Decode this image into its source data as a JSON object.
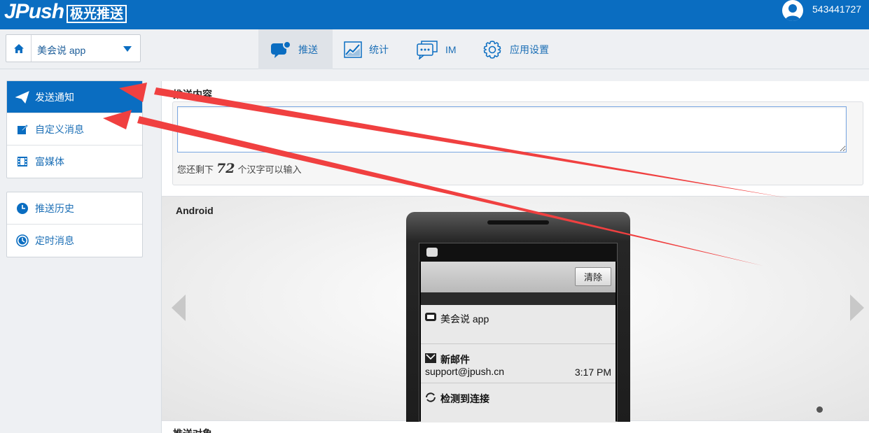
{
  "header": {
    "logo_text": "JPush",
    "logo_cn": "极光推送",
    "username": "543441727"
  },
  "nav": {
    "app_name": "美会说 app",
    "tabs": [
      {
        "label": "推送",
        "active": true
      },
      {
        "label": "统计",
        "active": false
      },
      {
        "label": "IM",
        "active": false
      },
      {
        "label": "应用设置",
        "active": false
      }
    ]
  },
  "sidebar": {
    "group1": [
      {
        "label": "发送通知",
        "icon": "paper-plane-icon",
        "active": true
      },
      {
        "label": "自定义消息",
        "icon": "edit-icon",
        "active": false
      },
      {
        "label": "富媒体",
        "icon": "film-icon",
        "active": false
      }
    ],
    "group2": [
      {
        "label": "推送历史",
        "icon": "clock-icon",
        "active": false
      },
      {
        "label": "定时消息",
        "icon": "timer-icon",
        "active": false
      }
    ]
  },
  "push_content": {
    "title": "推送内容",
    "value": "",
    "remain_prefix": "您还剩下",
    "remain_count": "72",
    "remain_suffix": "个汉字可以输入"
  },
  "preview": {
    "platform": "Android",
    "clear_label": "清除",
    "notifications": [
      {
        "title": "美会说 app",
        "sub": "",
        "time": ""
      },
      {
        "title": "新邮件",
        "sub": "support@jpush.cn",
        "time": "3:17 PM"
      },
      {
        "title": "检测到连接",
        "sub": "",
        "time": ""
      }
    ]
  },
  "next_section": {
    "title": "推送对象"
  },
  "colors": {
    "brand": "#0a6dc1",
    "annotation": "#f04040"
  }
}
